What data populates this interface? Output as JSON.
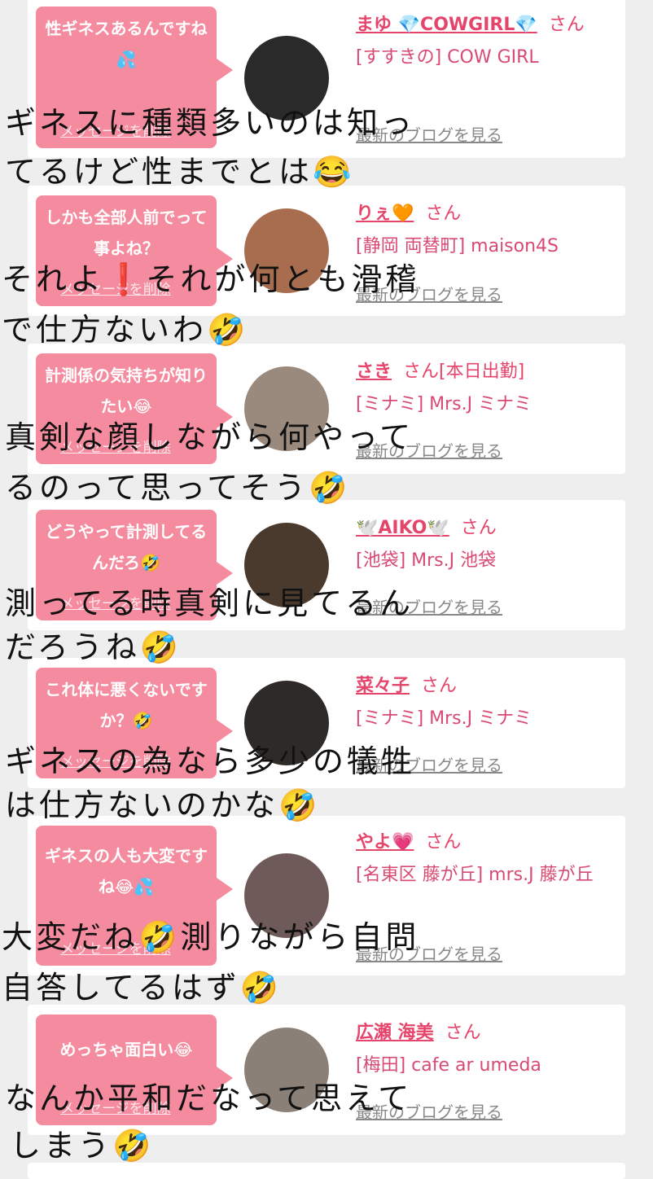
{
  "entries": [
    {
      "message": "性ギネスあるんですね💦",
      "delete_label": "メッセージを削除",
      "name": "まゆ 💎COWGIRL💎",
      "honorific": "さん",
      "shop": "[すすきの] COW GIRL",
      "blog": "最新のブログを見る",
      "avatar_color": "#2a2a2a"
    },
    {
      "message": "しかも全部人前でって事よね？",
      "delete_label": "メッセージを削除",
      "name": "りぇ🧡",
      "honorific": "さん",
      "shop": "[静岡 両替町] maison4S",
      "blog": "最新のブログを見る",
      "avatar_color": "#a86c4e"
    },
    {
      "message": "計測係の気持ちが知りたい😂",
      "delete_label": "メッセージを削除",
      "name": "さき",
      "honorific": "さん[本日出勤]",
      "shop": "[ミナミ] Mrs.J ミナミ",
      "blog": "最新のブログを見る",
      "avatar_color": "#9a8a7e"
    },
    {
      "message": "どうやって計測してるんだろ🤣",
      "delete_label": "メッセージを削除",
      "name": "🕊️AIKO🕊️",
      "honorific": "さん",
      "shop": "[池袋] Mrs.J 池袋",
      "blog": "最新のブログを見る",
      "avatar_color": "#4a3a2e"
    },
    {
      "message": "これ体に悪くないですか？🤣",
      "delete_label": "メッセージを削除",
      "name": "菜々子",
      "honorific": "さん",
      "shop": "[ミナミ] Mrs.J ミナミ",
      "blog": "最新のブログを見る",
      "avatar_color": "#2e2a28"
    },
    {
      "message": "ギネスの人も大変ですね😂💦",
      "delete_label": "メッセージを削除",
      "name": "やよ💗",
      "honorific": "さん",
      "shop": "[名東区 藤が丘] mrs.J 藤が丘",
      "blog": "最新のブログを見る",
      "avatar_color": "#6e5a58"
    },
    {
      "message": "めっちゃ面白い😂",
      "delete_label": "メッセージを削除",
      "name": "広瀬 海美",
      "honorific": "さん",
      "shop": "[梅田] cafe ar umeda",
      "blog": "最新のブログを見る",
      "avatar_color": "#8a8078"
    }
  ],
  "handwriting": [
    "ギネスに種類多いのは知っ",
    "てるけど性までとは😂",
    "それよ❗️それが何とも滑稽",
    "で仕方ないわ🤣",
    "真剣な顔しながら何やって",
    "るのって思ってそう🤣",
    "測ってる時真剣に見てるん",
    "だろうね🤣",
    "ギネスの為なら多少の犠牲",
    "は仕方ないのかな🤣",
    "大変だね🤣測りながら自問",
    "自答してるはず🤣",
    "なんか平和だなって思えて",
    "しまう🤣"
  ]
}
